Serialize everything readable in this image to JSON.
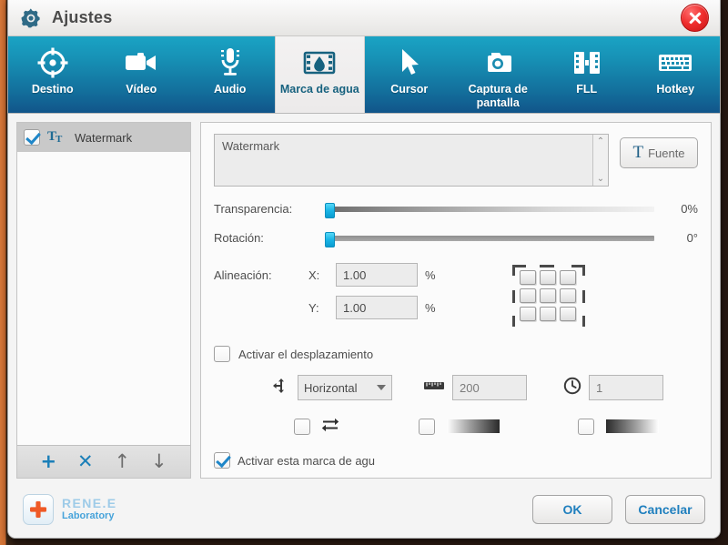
{
  "window": {
    "title": "Ajustes",
    "close_label": "×",
    "gear_icon": "gear-icon",
    "close_icon": "close-icon"
  },
  "tabs": [
    {
      "label": "Destino",
      "icon": "target-icon",
      "active": false
    },
    {
      "label": "Vídeo",
      "icon": "video-camera-icon",
      "active": false
    },
    {
      "label": "Audio",
      "icon": "microphone-icon",
      "active": false
    },
    {
      "label": "Marca de agua",
      "icon": "watermark-film-icon",
      "active": true
    },
    {
      "label": "Cursor",
      "icon": "cursor-arrow-icon",
      "active": false
    },
    {
      "label": "Captura de pantalla",
      "icon": "camera-icon",
      "active": false
    },
    {
      "label": "FLL",
      "icon": "film-strip-icon",
      "active": false
    },
    {
      "label": "Hotkey",
      "icon": "keyboard-icon",
      "active": false
    }
  ],
  "list_panel": {
    "items": [
      {
        "label": "Watermark",
        "checked": true,
        "icon": "text-tt-icon"
      }
    ],
    "toolbar": {
      "add": "+",
      "delete": "✕",
      "move_up": "↑",
      "move_down": "↓"
    }
  },
  "settings": {
    "watermark_text": "Watermark",
    "font_button": {
      "label": "Fuente",
      "icon": "font-t-icon"
    },
    "scroll_up": "⌃",
    "scroll_down": "⌄",
    "transparency": {
      "label": "Transparencia:",
      "value": "0%",
      "handle_pct": 0
    },
    "rotation": {
      "label": "Rotación:",
      "value": "0°",
      "handle_pct": 0
    },
    "alignment": {
      "label": "Alineación:",
      "x_label": "X:",
      "x_value": "1.00",
      "y_label": "Y:",
      "y_value": "1.00",
      "unit": "%"
    },
    "scroll_enable": {
      "label": "Activar el desplazamiento",
      "checked": false
    },
    "direction": {
      "value": "Horizontal",
      "icon": "move-arrows-icon"
    },
    "distance": {
      "value": "200",
      "icon": "ruler-icon"
    },
    "duration": {
      "value": "1",
      "icon": "clock-icon"
    },
    "loop_option": {
      "checked": false,
      "icon": "loop-repeat-icon"
    },
    "fade_in_option": {
      "checked": false,
      "icon": "fade-in-gradient-icon"
    },
    "fade_out_option": {
      "checked": false,
      "icon": "fade-out-gradient-icon"
    },
    "activate_watermark": {
      "label": "Activar esta marca de agu",
      "checked": true
    }
  },
  "footer": {
    "logo_main": "RENE.E",
    "logo_sub": "Laboratory",
    "logo_icon": "red-cross-icon",
    "ok_label": "OK",
    "cancel_label": "Cancelar"
  },
  "colors": {
    "tab_bar_top": "#1aa3c4",
    "tab_bar_bottom": "#11558a",
    "accent_blue": "#1f7fbe",
    "close_red": "#ef2d2d",
    "slider_handle": "#19b5e6"
  }
}
